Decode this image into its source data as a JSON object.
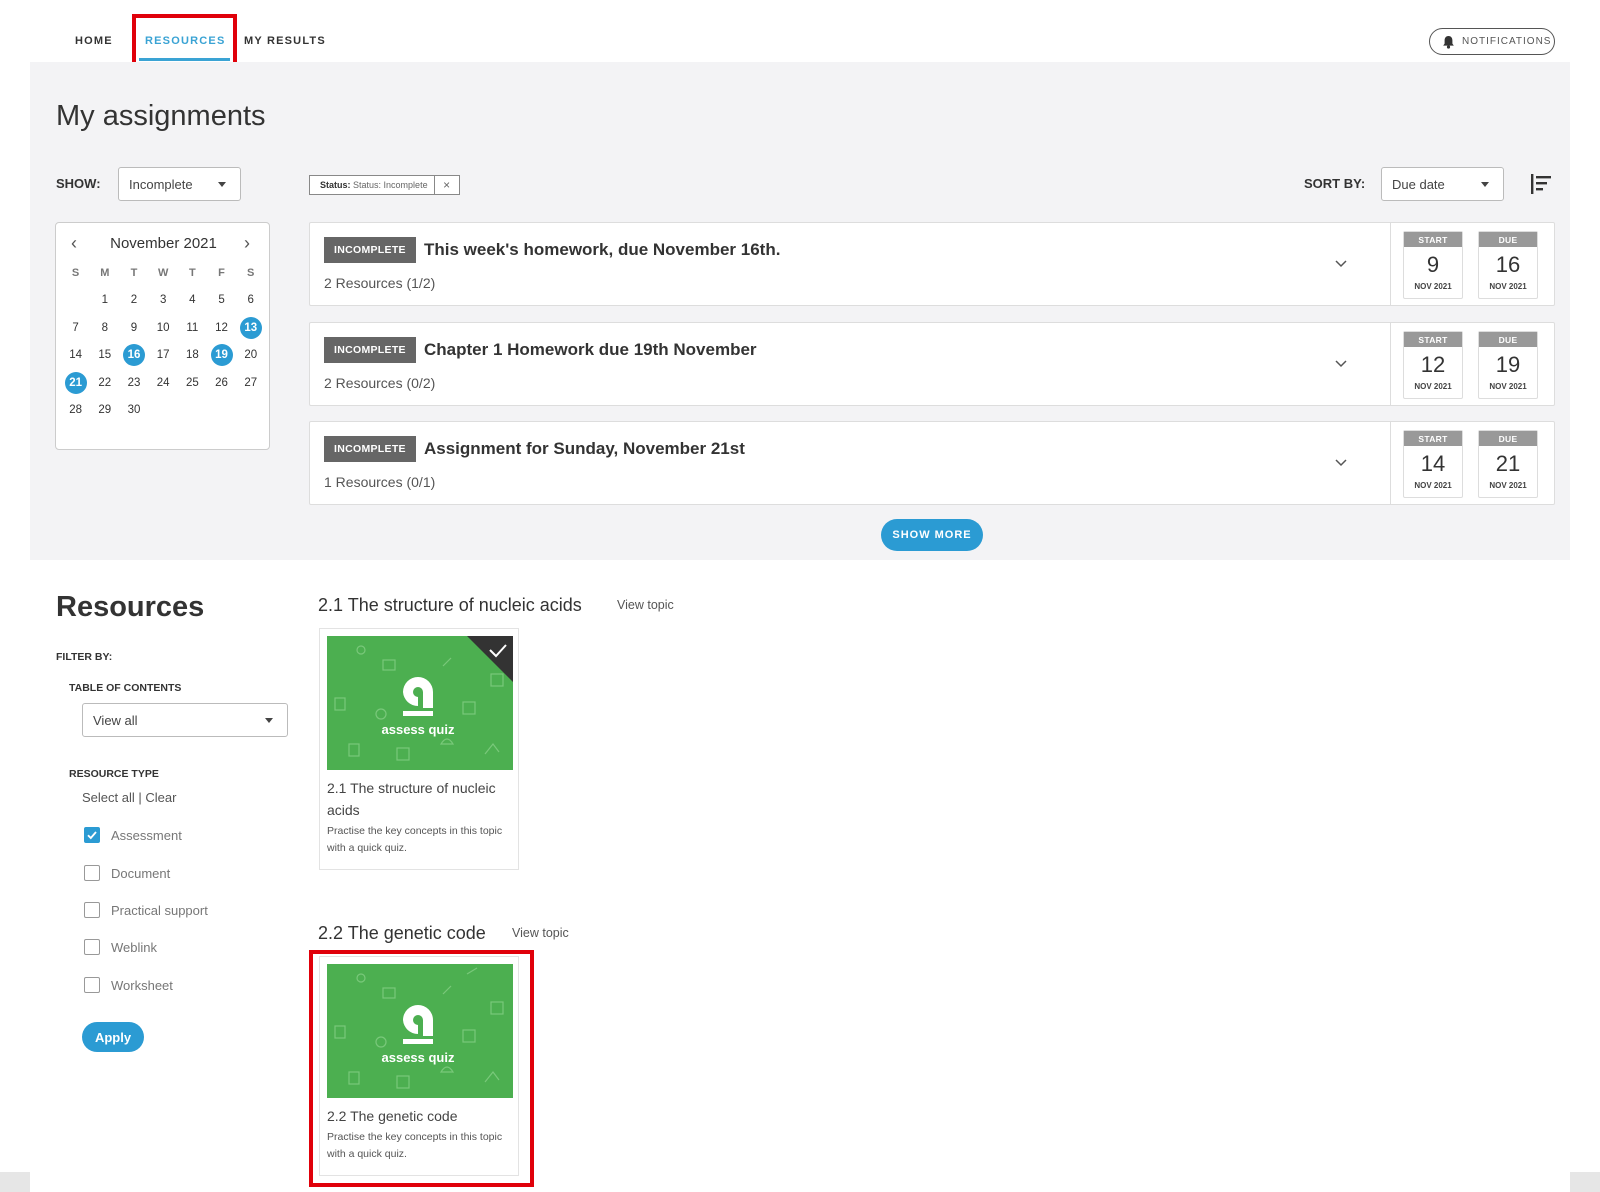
{
  "nav": {
    "home": "HOME",
    "resources": "RESOURCES",
    "my_results": "MY RESULTS",
    "notifications": "NOTIFICATIONS"
  },
  "assignments": {
    "title": "My assignments",
    "show_label": "SHOW:",
    "show_value": "Incomplete",
    "filter_chip": {
      "key": "Status:",
      "value": "Status: Incomplete",
      "remove": "×"
    },
    "sort_label": "SORT BY:",
    "sort_value": "Due date",
    "show_more": "SHOW MORE",
    "items": [
      {
        "status": "INCOMPLETE",
        "title": "This week's homework, due November 16th.",
        "resources": "2 Resources (1/2)",
        "start": {
          "label": "START",
          "day": "9",
          "month": "NOV 2021"
        },
        "due": {
          "label": "DUE",
          "day": "16",
          "month": "NOV 2021"
        }
      },
      {
        "status": "INCOMPLETE",
        "title": "Chapter 1 Homework due 19th November",
        "resources": "2 Resources (0/2)",
        "start": {
          "label": "START",
          "day": "12",
          "month": "NOV 2021"
        },
        "due": {
          "label": "DUE",
          "day": "19",
          "month": "NOV 2021"
        }
      },
      {
        "status": "INCOMPLETE",
        "title": "Assignment for Sunday, November 21st",
        "resources": "1 Resources (0/1)",
        "start": {
          "label": "START",
          "day": "14",
          "month": "NOV 2021"
        },
        "due": {
          "label": "DUE",
          "day": "21",
          "month": "NOV 2021"
        }
      }
    ]
  },
  "calendar": {
    "month": "November 2021",
    "prev": "‹",
    "next": "›",
    "weekdays": [
      "S",
      "M",
      "T",
      "W",
      "T",
      "F",
      "S"
    ],
    "weeks": [
      [
        "",
        "1",
        "2",
        "3",
        "4",
        "5",
        "6"
      ],
      [
        "7",
        "8",
        "9",
        "10",
        "11",
        "12",
        "13"
      ],
      [
        "14",
        "15",
        "16",
        "17",
        "18",
        "19",
        "20"
      ],
      [
        "21",
        "22",
        "23",
        "24",
        "25",
        "26",
        "27"
      ],
      [
        "28",
        "29",
        "30",
        "",
        "",
        "",
        ""
      ]
    ],
    "highlighted": [
      "13",
      "16",
      "19",
      "21"
    ],
    "highlight_color": "#2b9bd3"
  },
  "resources": {
    "title": "Resources",
    "filter_by": "FILTER BY:",
    "toc_label": "TABLE OF CONTENTS",
    "toc_value": "View all",
    "type_label": "RESOURCE TYPE",
    "select_all": "Select all",
    "separator": "|",
    "clear": "Clear",
    "types": [
      {
        "label": "Assessment",
        "checked": true
      },
      {
        "label": "Document",
        "checked": false
      },
      {
        "label": "Practical support",
        "checked": false
      },
      {
        "label": "Weblink",
        "checked": false
      },
      {
        "label": "Worksheet",
        "checked": false
      }
    ],
    "apply": "Apply",
    "topics": [
      {
        "title": "2.1 The structure of nucleic acids",
        "view": "View topic",
        "card": {
          "brand": "assess quiz",
          "name": "2.1 The structure of nucleic acids",
          "desc": "Practise the key concepts in this topic with a quick quiz.",
          "completed": true
        }
      },
      {
        "title": "2.2 The genetic code",
        "view": "View topic",
        "card": {
          "brand": "assess quiz",
          "name": "2.2 The genetic code",
          "desc": "Practise the key concepts in this topic with a quick quiz.",
          "completed": false
        }
      }
    ]
  },
  "colors": {
    "accent": "#2b9bd3",
    "quiz_green": "#4caf50",
    "highlight_red": "#e0000a",
    "status_gray": "#666666"
  }
}
